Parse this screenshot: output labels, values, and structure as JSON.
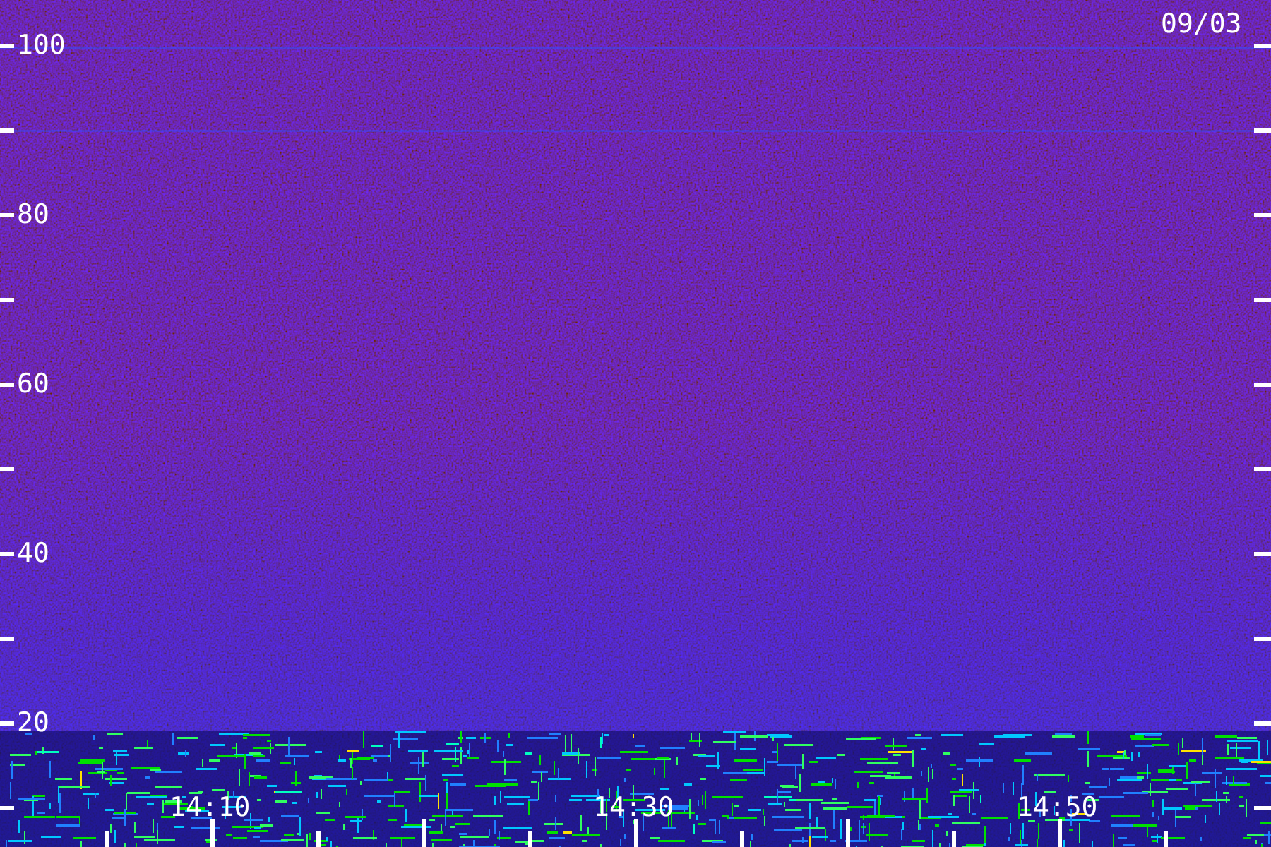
{
  "date": "09/03",
  "y_axis": {
    "labels": [
      "100",
      "80",
      "60",
      "40",
      "20"
    ]
  },
  "x_axis": {
    "labels": [
      "14:10",
      "14:30",
      "14:50"
    ]
  }
}
